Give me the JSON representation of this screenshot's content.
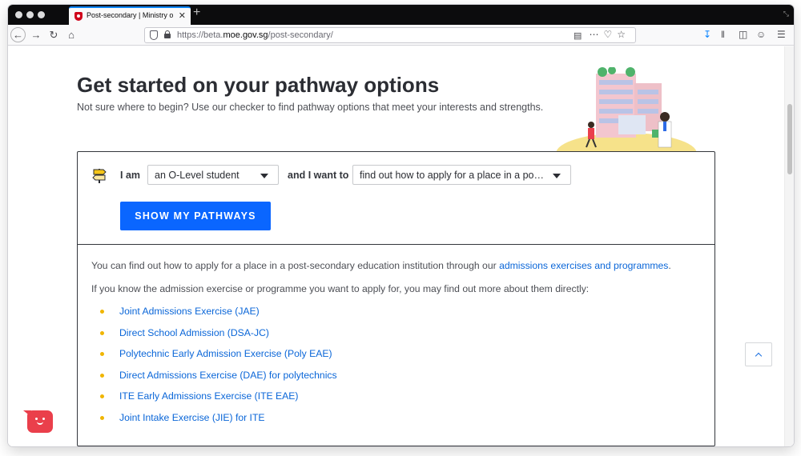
{
  "browser": {
    "tab_title": "Post-secondary | Ministry of Ed",
    "tab_close": "✕",
    "new_tab": "+",
    "url_prefix": "https://beta.",
    "url_domain": "moe.gov.sg",
    "url_path": "/post-secondary/"
  },
  "page": {
    "title": "Get started on your pathway options",
    "subtitle": "Not sure where to begin? Use our checker to find pathway options that meet your interests and strengths."
  },
  "checker": {
    "i_am_label": "I am",
    "role_value": "an O-Level student",
    "and_want_label": "and I want to",
    "goal_value": "find out how to apply for a place in a po…",
    "cta_label": "SHOW MY PATHWAYS"
  },
  "result": {
    "intro_before": "You can find out how to apply for a place in a post-secondary education institution through our ",
    "intro_link": "admissions exercises and programmes",
    "intro_after": ".",
    "direct_text": "If you know the admission exercise or programme you want to apply for, you may find out more about them directly:",
    "links": [
      {
        "label": "Joint Admissions Exercise (JAE)"
      },
      {
        "label": "Direct School Admission (DSA-JC)"
      },
      {
        "label": "Polytechnic Early Admission Exercise (Poly EAE)"
      },
      {
        "label": "Direct Admissions Exercise (DAE) for polytechnics"
      },
      {
        "label": "ITE Early Admissions Exercise (ITE EAE)"
      },
      {
        "label": "Joint Intake Exercise (JIE) for ITE"
      }
    ]
  },
  "colors": {
    "primary": "#0a66ff",
    "link": "#0a66d8",
    "bullet": "#f0b500",
    "chat": "#ea3f4b"
  }
}
